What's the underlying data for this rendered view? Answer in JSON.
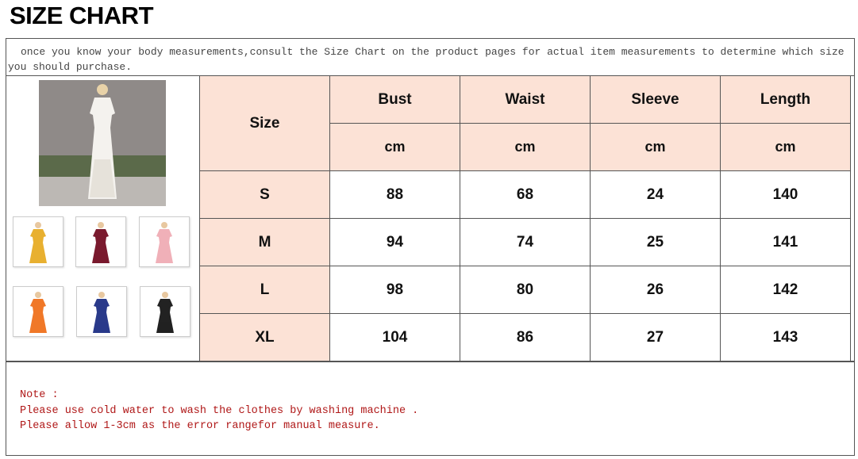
{
  "title": "SIZE CHART",
  "intro": "once you know your body measurements,consult the Size Chart on the product pages for actual item measurements to determine which size you should purchase.",
  "table": {
    "size_label": "Size",
    "headers": [
      "Bust",
      "Waist",
      "Sleeve",
      "Length"
    ],
    "units": [
      "cm",
      "cm",
      "cm",
      "cm"
    ],
    "rows": [
      {
        "size": "S",
        "values": [
          "88",
          "68",
          "24",
          "140"
        ]
      },
      {
        "size": "M",
        "values": [
          "94",
          "74",
          "25",
          "141"
        ]
      },
      {
        "size": "L",
        "values": [
          "98",
          "80",
          "26",
          "142"
        ]
      },
      {
        "size": "XL",
        "values": [
          "104",
          "86",
          "27",
          "143"
        ]
      }
    ]
  },
  "colors": {
    "header_fill": "#fce2d6",
    "note_text": "#b01818",
    "border": "#555555"
  },
  "product_images": {
    "main": "white-dress-photo",
    "thumbnails": [
      {
        "name": "yellow-dress-thumb",
        "color": "#e8b030"
      },
      {
        "name": "burgundy-dress-thumb",
        "color": "#7a1a2e"
      },
      {
        "name": "pink-dress-thumb",
        "color": "#f0b0b8"
      },
      {
        "name": "orange-dress-thumb",
        "color": "#f07828"
      },
      {
        "name": "navy-dress-thumb",
        "color": "#2a3a8a"
      },
      {
        "name": "black-dress-thumb",
        "color": "#222222"
      }
    ]
  },
  "notes": {
    "heading": "Note :",
    "lines": [
      "Please use cold water to wash the clothes by washing machine .",
      "Please allow 1-3cm as the error rangefor manual measure."
    ]
  }
}
